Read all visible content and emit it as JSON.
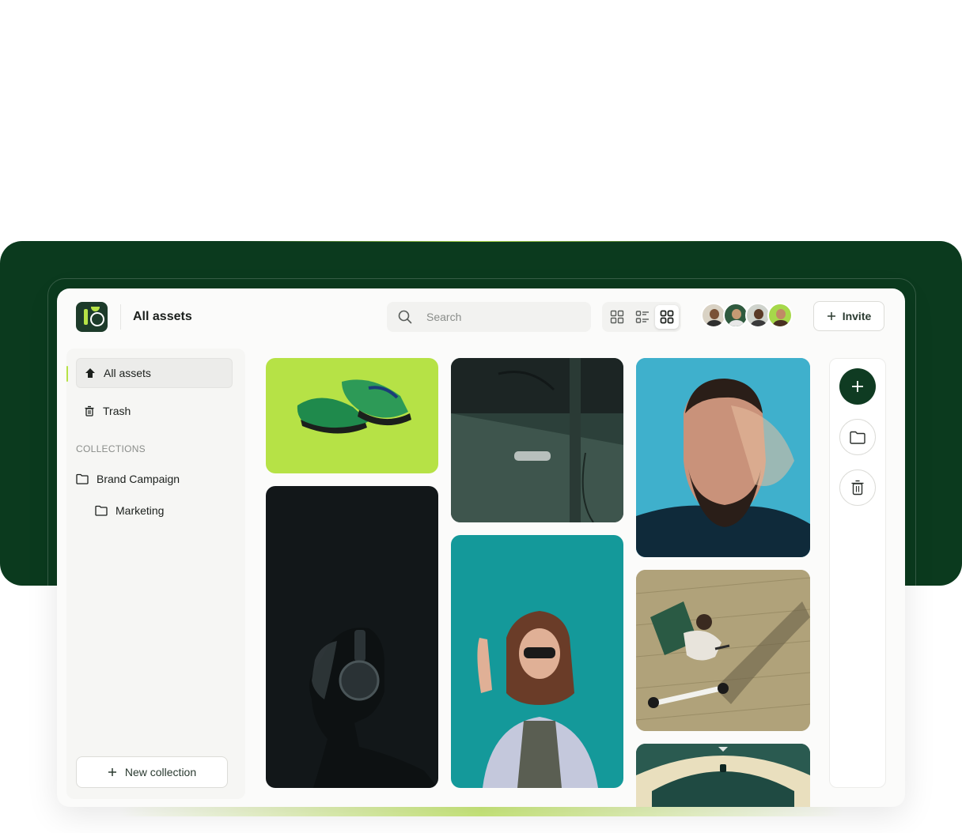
{
  "header": {
    "title": "All assets",
    "search_placeholder": "Search",
    "invite_label": "Invite"
  },
  "view_modes": [
    "grid-small-icon",
    "list-icon",
    "grid-large-icon"
  ],
  "active_view_mode": "grid-large-icon",
  "collaborators": [
    "avatar-1",
    "avatar-2",
    "avatar-3",
    "avatar-4"
  ],
  "sidebar": {
    "items": [
      {
        "label": "All assets",
        "icon": "home-icon",
        "active": true
      },
      {
        "label": "Trash",
        "icon": "trash-icon",
        "active": false
      }
    ],
    "collections_label": "COLLECTIONS",
    "collections": [
      {
        "label": "Brand Campaign",
        "icon": "folder-icon"
      },
      {
        "label": "Marketing",
        "icon": "folder-icon",
        "nested": true
      }
    ],
    "new_collection_label": "New collection"
  },
  "gallery": [
    "green sneakers",
    "vintage car door",
    "man with beard portrait",
    "man with headphones",
    "woman with sunglasses",
    "delivery rider on scooter",
    "architectural ceiling"
  ],
  "rail": [
    "add-icon",
    "folder-icon",
    "trash-icon"
  ],
  "colors": {
    "brand_dark": "#0b3a1e",
    "accent_lime": "#b6e246",
    "app_bg": "#fbfbfa"
  }
}
